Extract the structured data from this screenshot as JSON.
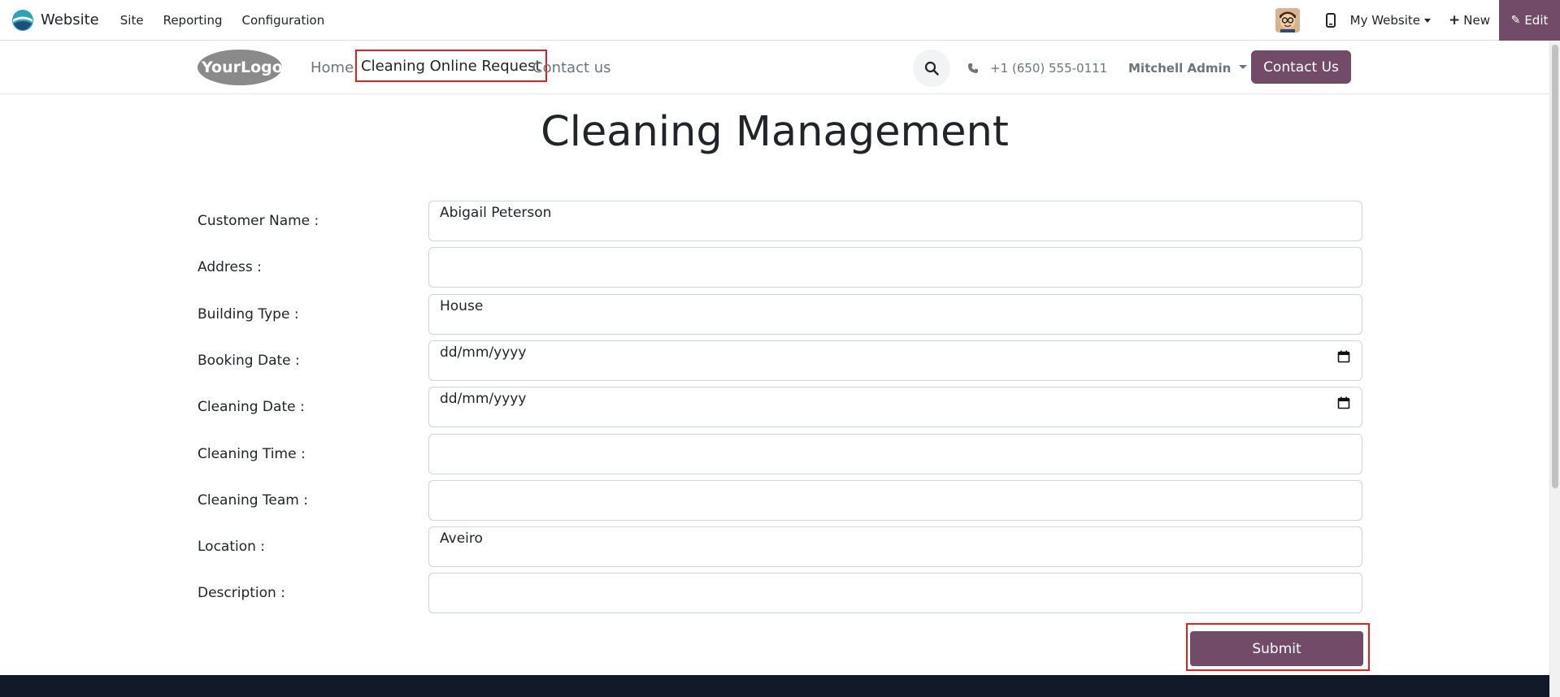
{
  "admin_bar": {
    "app_name": "Website",
    "menu": [
      "Site",
      "Reporting",
      "Configuration"
    ],
    "website_selector": "My Website",
    "new_label": "New",
    "edit_label": "Edit"
  },
  "site_header": {
    "logo_text": "YourLogo",
    "nav": {
      "home": "Home",
      "cleaning": "Cleaning Online Request",
      "contact": "Contact us"
    },
    "phone": "+1 (650) 555-0111",
    "user": "Mitchell Admin",
    "contact_button": "Contact Us"
  },
  "page": {
    "title": "Cleaning Management"
  },
  "form": {
    "fields": [
      {
        "label": "Customer Name :",
        "value": "Abigail Peterson"
      },
      {
        "label": "Address :",
        "value": ""
      },
      {
        "label": "Building Type :",
        "value": "House"
      },
      {
        "label": "Booking Date :",
        "value": "dd/mm/yyyy"
      },
      {
        "label": "Cleaning Date :",
        "value": "dd/mm/yyyy"
      },
      {
        "label": "Cleaning Time :",
        "value": ""
      },
      {
        "label": "Cleaning Team :",
        "value": ""
      },
      {
        "label": "Location :",
        "value": "Aveiro"
      },
      {
        "label": "Description :",
        "value": ""
      }
    ],
    "submit_label": "Submit"
  },
  "colors": {
    "brand": "#714b67",
    "highlight": "#e02020",
    "footer": "#111827"
  }
}
